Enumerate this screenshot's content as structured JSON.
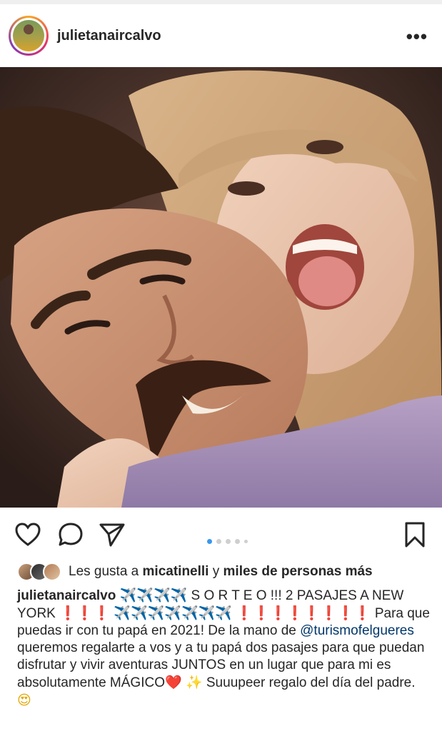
{
  "post": {
    "username": "julietanaircalvo",
    "more_label": "•••",
    "photo_alt": ""
  },
  "actions": {
    "like_icon": "heart-icon",
    "comment_icon": "comment-icon",
    "share_icon": "share-icon",
    "save_icon": "bookmark-icon",
    "carousel": {
      "count": 5,
      "active_index": 0
    }
  },
  "likes": {
    "prefix": "Les gusta a",
    "user": "micatinelli",
    "joiner": "y",
    "rest": "miles de personas más"
  },
  "caption": {
    "user": "julietanaircalvo",
    "planes_1": "✈️✈️✈️✈️",
    "text_1": " S O R T E O !!! 2 PASAJES A NEW YORK ",
    "excl_1": "❗️❗️❗️",
    "planes_2": "✈️✈️✈️✈️✈️✈️✈️",
    "excl_2": "❗️❗️❗️❗️❗️❗️❗️❗️",
    "text_2": " Para que puedas ir con tu papá en 2021! De la mano de ",
    "mention": "@turismofelgueres",
    "text_3": " queremos regalarte a vos y a tu papá dos pasajes para que puedan disfrutar y vivir aventuras JUNTOS en un lugar que para mi es absolutamente MÁGICO",
    "heart": "❤️",
    "sparkles": "✨",
    "text_4": " Suuupeer regalo del día del padre. ",
    "face": "😍"
  },
  "colors": {
    "accent": "#3897f0",
    "mention": "#00376b",
    "text": "#262626"
  }
}
